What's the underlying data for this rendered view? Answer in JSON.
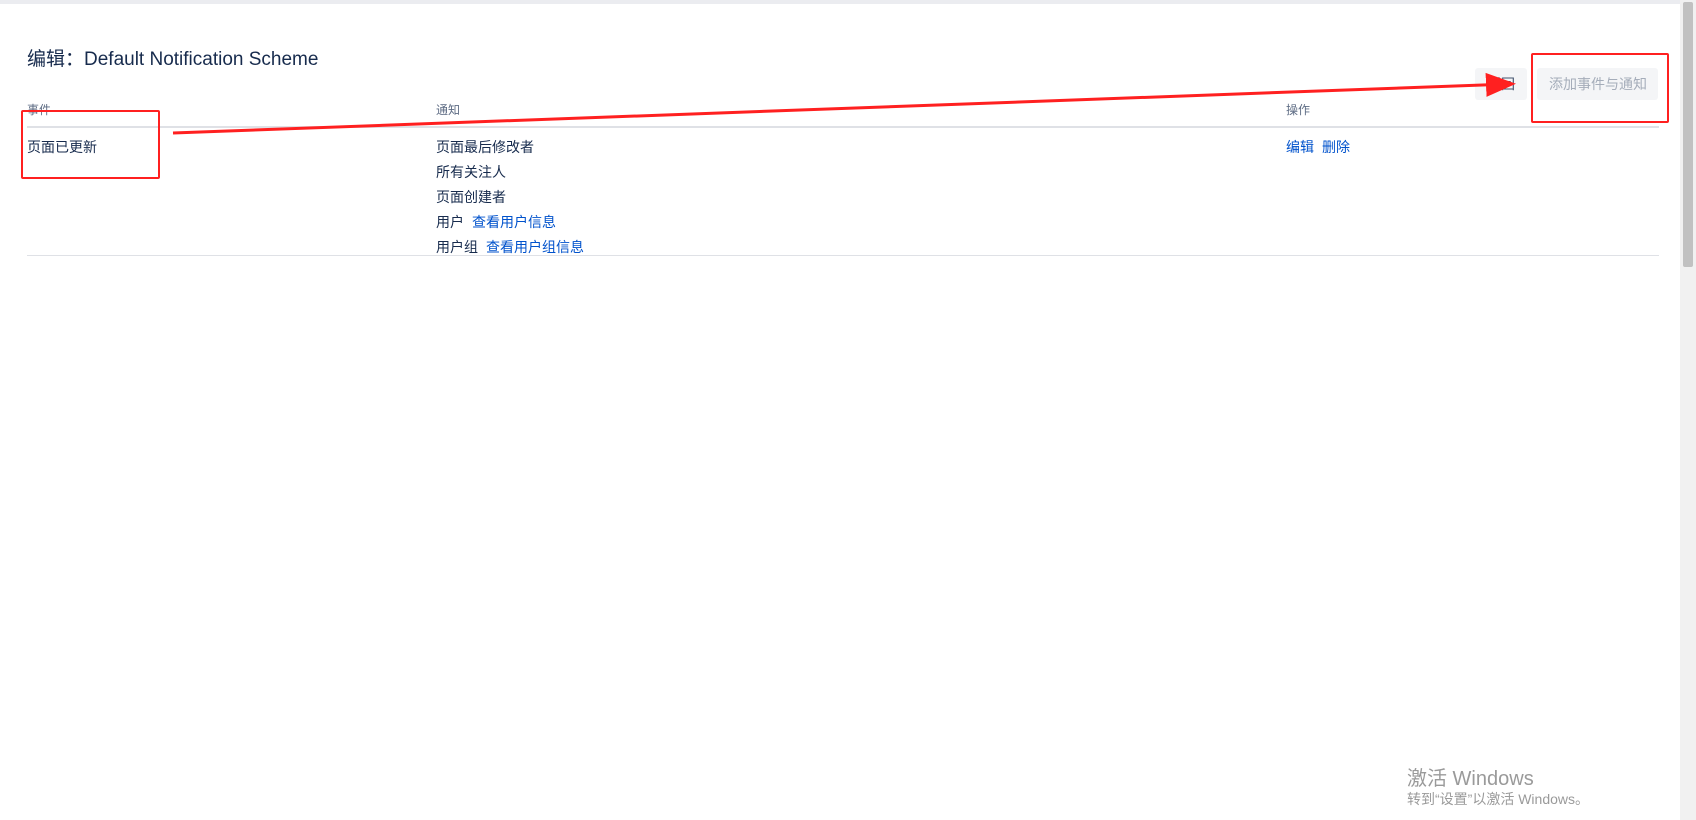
{
  "page": {
    "title": "编辑：Default Notification Scheme"
  },
  "toolbar": {
    "back_label": "返回",
    "add_label": "添加事件与通知"
  },
  "table": {
    "columns": [
      "事件",
      "通知",
      "操作"
    ],
    "rows": [
      {
        "event": "页面已更新",
        "notifications": [
          {
            "text": "页面最后修改者"
          },
          {
            "text": "所有关注人"
          },
          {
            "text": "页面创建者"
          },
          {
            "text": "用户",
            "link": "查看用户信息"
          },
          {
            "text": "用户组",
            "link": "查看用户组信息"
          }
        ],
        "actions": [
          "编辑",
          "删除"
        ]
      }
    ]
  },
  "watermark": {
    "title": "激活 Windows",
    "subtitle": "转到“设置”以激活 Windows。"
  },
  "annotation": {
    "color": "#ff2020"
  }
}
